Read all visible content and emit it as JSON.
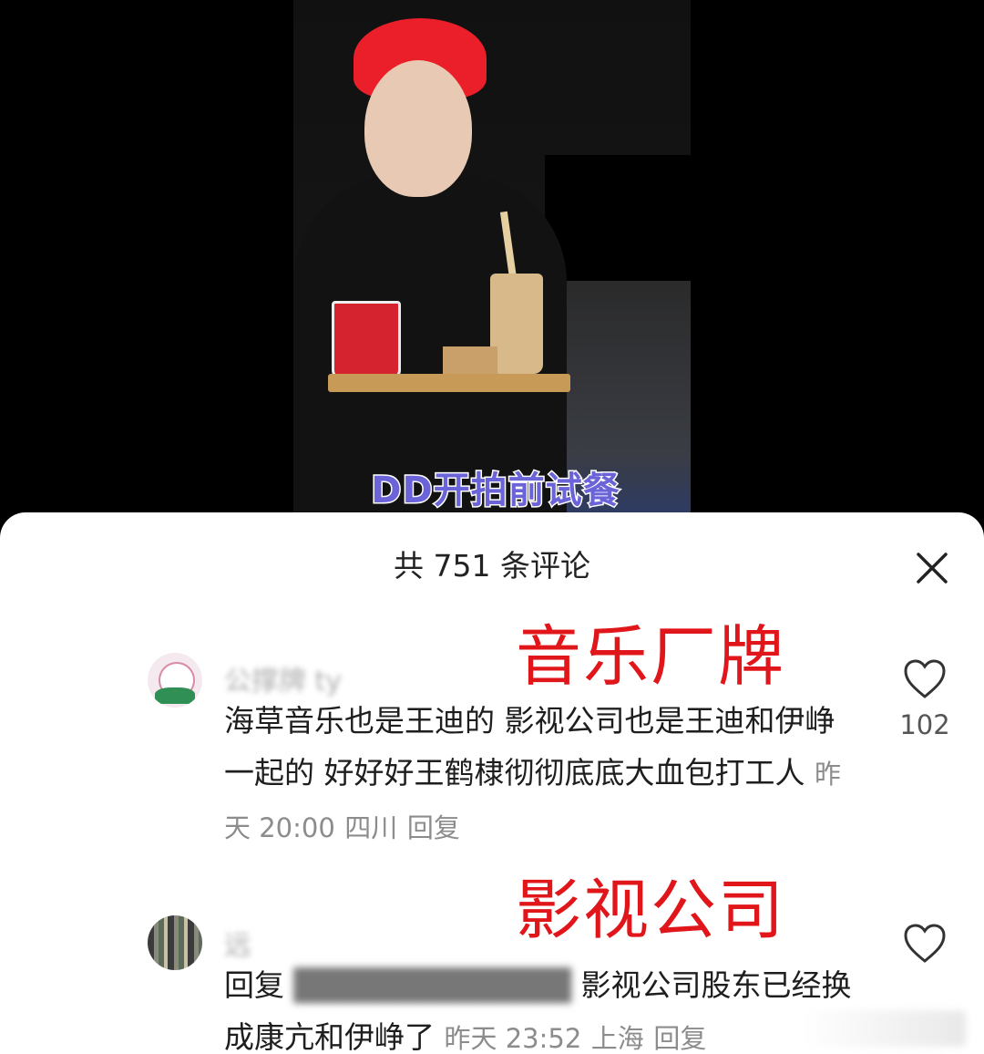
{
  "video": {
    "subtitle": "DD开拍前试餐"
  },
  "comments_panel": {
    "header": "共 751 条评论",
    "close_icon": "close-icon",
    "overlay_labels": [
      "音乐厂牌",
      "影视公司"
    ],
    "comments": [
      {
        "username": "公撑牌 ty",
        "text": "海草音乐也是王迪的 影视公司也是王迪和伊峥一起的 好好好王鹤棣彻彻底底大血包打工人",
        "time": "昨天 20:00",
        "location": "四川",
        "reply_label": "回复",
        "likes": "102",
        "like_icon": "heart-outline-icon"
      },
      {
        "username": "远",
        "reply_prefix": "回复",
        "text": "影视公司股东已经换成康亢和伊峥了",
        "time": "昨天 23:52",
        "location": "上海",
        "reply_label": "回复",
        "like_icon": "heart-outline-icon"
      }
    ]
  }
}
